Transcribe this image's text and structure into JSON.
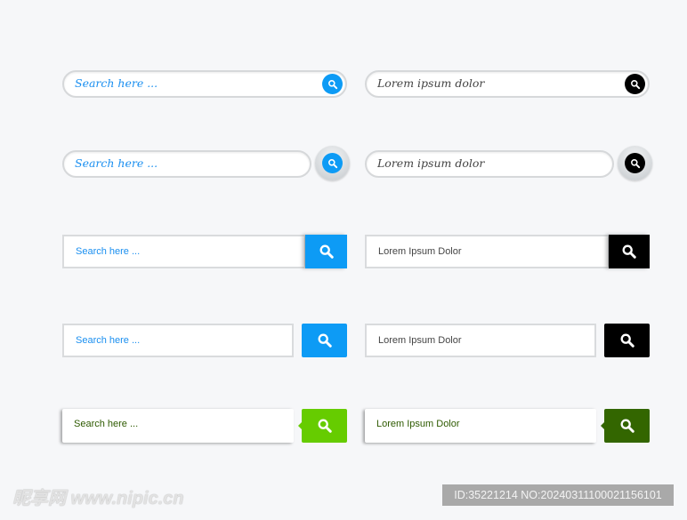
{
  "colors": {
    "blue": "#0d9bf5",
    "black": "#000000",
    "green": "#66cc00",
    "dark_green": "#336600",
    "blue_text": "#1a8ff0",
    "gray_text": "#444444",
    "green_text": "#2e5a00"
  },
  "row1": {
    "left_placeholder": "Search here ...",
    "right_placeholder": "Lorem ipsum dolor"
  },
  "row2": {
    "left_placeholder": "Search here ...",
    "right_placeholder": "Lorem ipsum dolor"
  },
  "row3": {
    "left_placeholder": "Search here ...",
    "right_placeholder": "Lorem Ipsum Dolor"
  },
  "row4": {
    "left_placeholder": "Search here ...",
    "right_placeholder": "Lorem Ipsum Dolor"
  },
  "row5": {
    "left_placeholder": "Search here ...",
    "right_placeholder": "Lorem Ipsum Dolor"
  },
  "watermark": {
    "logo": "昵享网 www.nipic.cn",
    "id_text": "ID:35221214 NO:20240311100021156101"
  }
}
